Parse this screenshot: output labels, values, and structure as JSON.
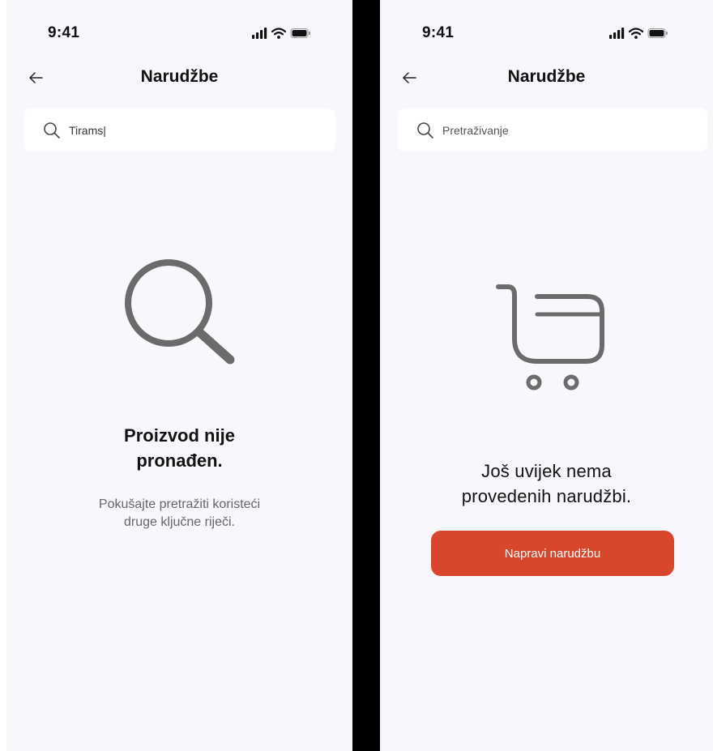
{
  "screens": [
    {
      "status_time": "9:41",
      "nav_title": "Narudžbe",
      "search": {
        "value": "Tirams|",
        "placeholder": ""
      },
      "empty_state": {
        "title_line1": "Proizvod nije",
        "title_line2": "pronađen.",
        "text_line1": "Pokušajte pretražiti koristeći",
        "text_line2": "druge ključne riječi."
      }
    },
    {
      "status_time": "9:41",
      "nav_title": "Narudžbe",
      "search": {
        "value": "",
        "placeholder": "Pretraživanje"
      },
      "empty_state": {
        "title_line1": "Još uvijek nema",
        "title_line2": "provedenih narudžbi.",
        "button_label": "Napravi narudžbu"
      }
    }
  ],
  "icons": {
    "status": [
      "signal-icon",
      "wifi-icon",
      "battery-icon"
    ],
    "back": "arrow-left-icon",
    "search": "search-icon",
    "empty_left": "magnifier-icon",
    "empty_right": "cart-icon"
  },
  "colors": {
    "background": "#f8f8fc",
    "divider": "#000000",
    "accent": "#d8472b",
    "icon_gray": "#6b6b6b"
  }
}
